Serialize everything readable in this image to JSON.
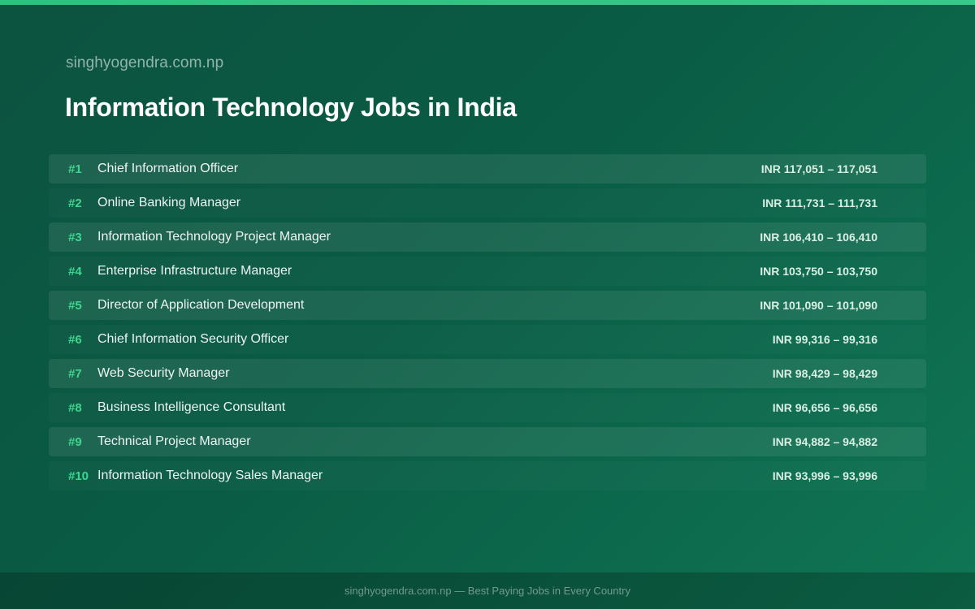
{
  "header": {
    "site": "singhyogendra.com.np",
    "title": "Information Technology Jobs in India"
  },
  "jobs": [
    {
      "rank": "#1",
      "title": "Chief Information Officer",
      "salary": "INR 117,051 – 117,051"
    },
    {
      "rank": "#2",
      "title": "Online Banking Manager",
      "salary": "INR 111,731 – 111,731"
    },
    {
      "rank": "#3",
      "title": "Information Technology Project Manager",
      "salary": "INR 106,410 – 106,410"
    },
    {
      "rank": "#4",
      "title": "Enterprise Infrastructure Manager",
      "salary": "INR 103,750 – 103,750"
    },
    {
      "rank": "#5",
      "title": "Director of Application Development",
      "salary": "INR 101,090 – 101,090"
    },
    {
      "rank": "#6",
      "title": "Chief Information Security Officer",
      "salary": "INR 99,316 – 99,316"
    },
    {
      "rank": "#7",
      "title": "Web Security Manager",
      "salary": "INR 98,429 – 98,429"
    },
    {
      "rank": "#8",
      "title": "Business Intelligence Consultant",
      "salary": "INR 96,656 – 96,656"
    },
    {
      "rank": "#9",
      "title": "Technical Project Manager",
      "salary": "INR 94,882 – 94,882"
    },
    {
      "rank": "#10",
      "title": "Information Technology Sales Manager",
      "salary": "INR 93,996 – 93,996"
    }
  ],
  "footer": {
    "text": "singhyogendra.com.np — Best Paying Jobs in Every Country"
  },
  "colors": {
    "accent": "#3ed58f",
    "top_bar": "#2fbf7f",
    "background": "#0a5c44"
  }
}
